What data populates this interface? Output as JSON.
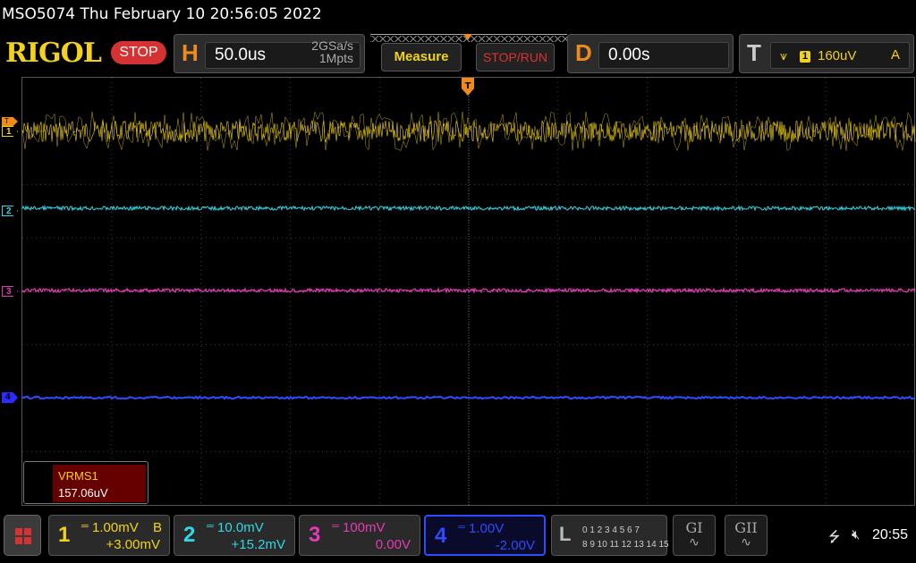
{
  "title": {
    "text": "MSO5074  Thu February 10 20:56:05 2022"
  },
  "brand": {
    "logo": "RIGOL",
    "run_state": "STOP"
  },
  "horizontal": {
    "letter": "H",
    "timebase": "50.0us",
    "sample_rate": "2GSa/s",
    "memory_depth": "1Mpts"
  },
  "buttons": {
    "measure": "Measure",
    "stop_run": "STOP/RUN"
  },
  "delay": {
    "letter": "D",
    "value": "0.00s"
  },
  "trigger": {
    "letter": "T",
    "source": "1",
    "level": "160uV",
    "mode": "A",
    "color": "#f2d21a"
  },
  "markers": {
    "ch1": "1",
    "ch2": "2",
    "ch3": "3",
    "ch4": "4",
    "trig_level": "T",
    "trig_pos": "T"
  },
  "measurement": {
    "label": "VRMS1",
    "value": "157.06uV"
  },
  "channels": [
    {
      "num": "1",
      "scale": "1.00mV",
      "bw": "B",
      "offset": "+3.00mV",
      "color": "#f2d21a"
    },
    {
      "num": "2",
      "scale": "10.0mV",
      "bw": "",
      "offset": "+15.2mV",
      "color": "#31d8e6"
    },
    {
      "num": "3",
      "scale": "100mV",
      "bw": "",
      "offset": "0.00V",
      "color": "#e53ab6"
    },
    {
      "num": "4",
      "scale": "1.00V",
      "bw": "",
      "offset": "-2.00V",
      "color": "#2f4bff"
    }
  ],
  "logic": {
    "letter": "L",
    "row1": "0 1 2 3  4 5 6 7",
    "row2": "8 9 10 11 12 13 14 15"
  },
  "generators": [
    {
      "label": "GI"
    },
    {
      "label": "GII"
    }
  ],
  "status": {
    "clock": "20:55",
    "usb_icon": "usb-icon",
    "speaker_icon": "speaker-mute-icon"
  }
}
